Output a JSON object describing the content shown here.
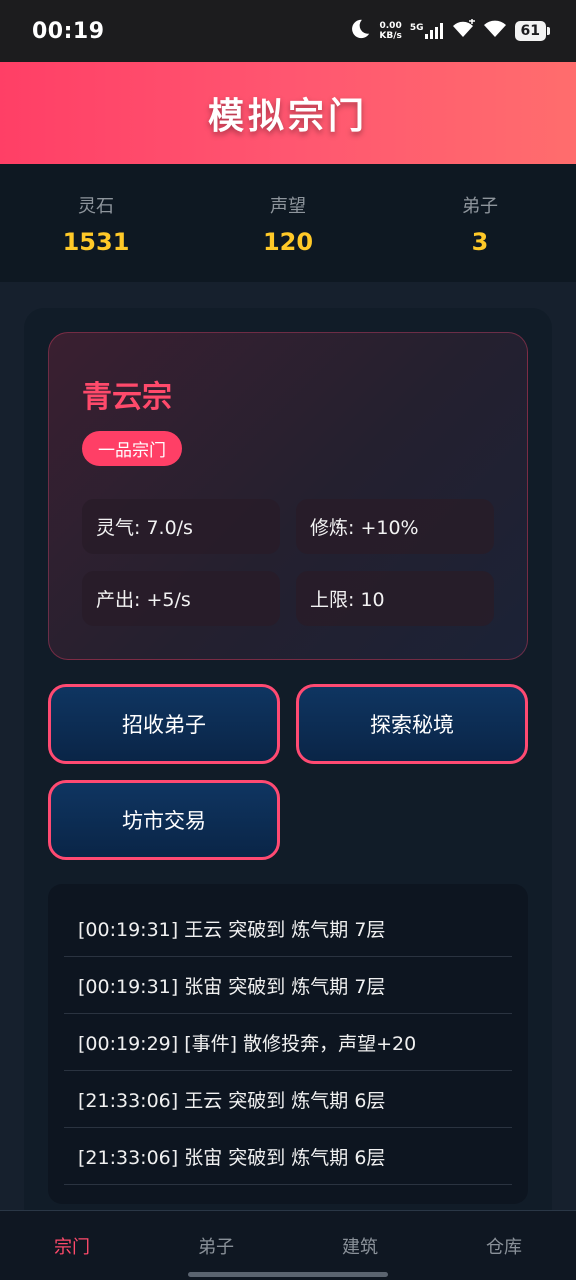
{
  "status_bar": {
    "time": "00:19",
    "net_speed_value": "0.00",
    "net_speed_unit": "KB/s",
    "network_type": "5G",
    "battery": "61",
    "icons": [
      "moon-icon",
      "signal-icon",
      "wifi-icon",
      "battery-icon"
    ]
  },
  "header": {
    "title": "模拟宗门"
  },
  "resources": [
    {
      "label": "灵石",
      "value": "1531"
    },
    {
      "label": "声望",
      "value": "120"
    },
    {
      "label": "弟子",
      "value": "3"
    }
  ],
  "sect": {
    "name": "青云宗",
    "rank": "一品宗门",
    "stats": [
      "灵气: 7.0/s",
      "修炼: +10%",
      "产出: +5/s",
      "上限: 10"
    ]
  },
  "actions": {
    "recruit": "招收弟子",
    "explore": "探索秘境",
    "market": "坊市交易"
  },
  "log": [
    "[00:19:31] 王云 突破到 炼气期 7层",
    "[00:19:31] 张宙 突破到 炼气期 7层",
    "[00:19:29] [事件] 散修投奔，声望+20",
    "[21:33:06] 王云 突破到 炼气期 6层",
    "[21:33:06] 张宙 突破到 炼气期 6层"
  ],
  "nav": {
    "items": [
      "宗门",
      "弟子",
      "建筑",
      "仓库"
    ],
    "active": "宗门"
  },
  "colors": {
    "accent": "#ff4a6b",
    "gold": "#ffc928",
    "button_bg": "#0f3561"
  }
}
